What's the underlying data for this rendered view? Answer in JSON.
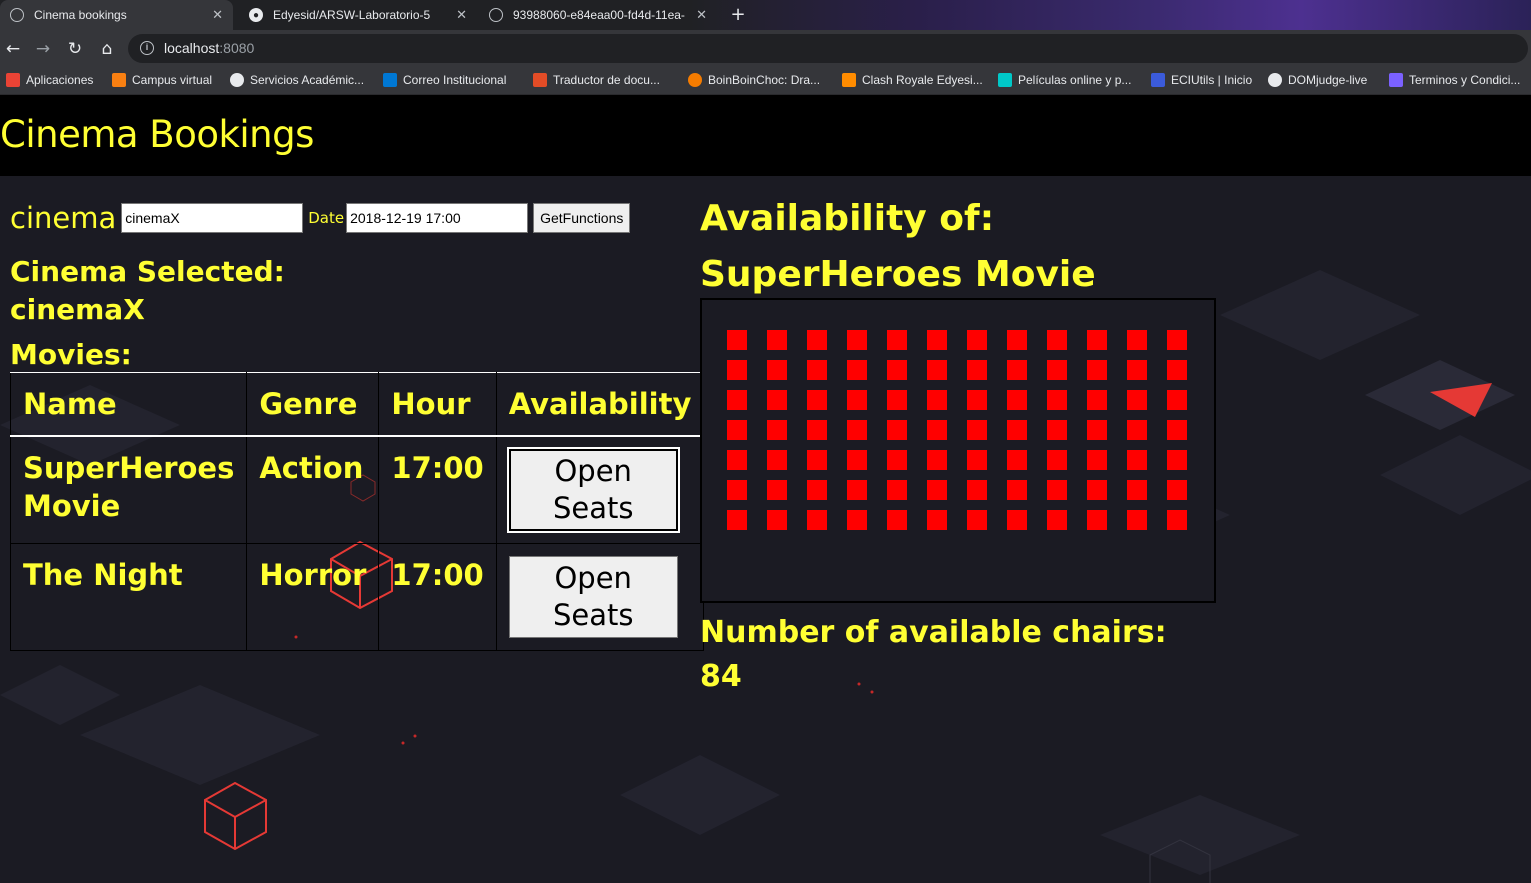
{
  "browser": {
    "tabs": [
      {
        "title": "Cinema bookings",
        "active": true
      },
      {
        "title": "Edyesid/ARSW-Laboratorio-5",
        "active": false
      },
      {
        "title": "93988060-e84eaa00-fd4d-11ea-",
        "active": false
      }
    ],
    "url_host": "localhost",
    "url_port": ":8080",
    "bookmarks": [
      {
        "label": "Aplicaciones",
        "icon": "apps-grid-icon",
        "color": "#ea4335"
      },
      {
        "label": "Campus virtual",
        "icon": "moodle-icon",
        "color": "#f98012"
      },
      {
        "label": "Servicios Académic...",
        "icon": "globe-icon",
        "color": "#e8eaed"
      },
      {
        "label": "Correo Institucional",
        "icon": "outlook-icon",
        "color": "#0078d4"
      },
      {
        "label": "Traductor de docu...",
        "icon": "translate-icon",
        "color": "#e34c26"
      },
      {
        "label": "BoinBoinChoc: Dra...",
        "icon": "orange-circle-icon",
        "color": "#f57c00"
      },
      {
        "label": "Clash Royale Edyesi...",
        "icon": "flag-icon",
        "color": "#ff8c00"
      },
      {
        "label": "Películas online y p...",
        "icon": "c-letter-icon",
        "color": "#00c8c8"
      },
      {
        "label": "ECIUtils | Inicio",
        "icon": "book-icon",
        "color": "#3b5bdb"
      },
      {
        "label": "DOMjudge-live",
        "icon": "globe-icon",
        "color": "#e8eaed"
      },
      {
        "label": "Terminos y Condici...",
        "icon": "kite-icon",
        "color": "#7b61ff"
      }
    ]
  },
  "app": {
    "title": "Cinema Bookings",
    "form": {
      "cinema_label": "cinema",
      "cinema_value": "cinemaX",
      "date_label": "Date",
      "date_value": "2018-12-19 17:00",
      "submit_label": "GetFunctions"
    },
    "cinema_selected_label": "Cinema Selected:",
    "cinema_selected_value": "cinemaX",
    "movies_label": "Movies:",
    "table": {
      "headers": [
        "Name",
        "Genre",
        "Hour",
        "Availability"
      ],
      "rows": [
        {
          "name": "SuperHeroes Movie",
          "genre": "Action",
          "hour": "17:00",
          "button": "Open Seats"
        },
        {
          "name": "The Night",
          "genre": "Horror",
          "hour": "17:00",
          "button": "Open Seats"
        }
      ]
    },
    "availability": {
      "title_line1": "Availability of:",
      "title_line2": "SuperHeroes Movie",
      "seat_rows": 7,
      "seat_cols": 12,
      "seat_color": "#ff0000",
      "chairs_label": "Number of available chairs:",
      "chairs_value": "84"
    },
    "colors": {
      "accent_text": "#ffff33",
      "header_bg": "#000000",
      "page_bg": "#1b1b23"
    }
  }
}
